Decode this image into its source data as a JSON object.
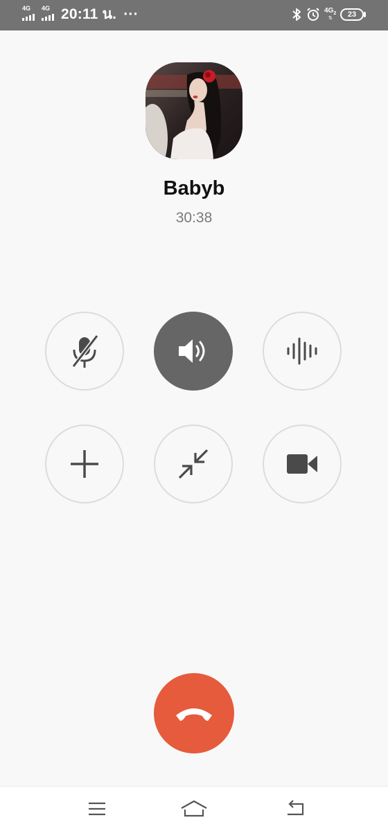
{
  "status_bar": {
    "sim1_network": "4G",
    "sim2_network": "4G",
    "time": "20:11 น.",
    "more": "···",
    "lte_label": "4G",
    "lte_sub": "2",
    "battery": "23"
  },
  "contact": {
    "name": "Babyb",
    "duration": "30:38"
  },
  "controls": [
    {
      "name": "mute",
      "icon": "microphone-off-icon",
      "active": false
    },
    {
      "name": "speaker",
      "icon": "speaker-icon",
      "active": true
    },
    {
      "name": "voice-effect",
      "icon": "sound-wave-icon",
      "active": false
    },
    {
      "name": "add-participant",
      "icon": "plus-icon",
      "active": false
    },
    {
      "name": "minimize",
      "icon": "minimize-arrows-icon",
      "active": false
    },
    {
      "name": "video",
      "icon": "video-camera-icon",
      "active": false
    }
  ],
  "end_call": {
    "icon": "hang-up-icon",
    "color": "#e55b3c"
  },
  "nav_bar": {
    "items": [
      "menu-icon",
      "home-icon",
      "back-icon"
    ]
  },
  "colors": {
    "status_bar_bg": "#737373",
    "screen_bg": "#f8f8f8",
    "active_control": "#666666",
    "icon": "#4a4a4a"
  }
}
